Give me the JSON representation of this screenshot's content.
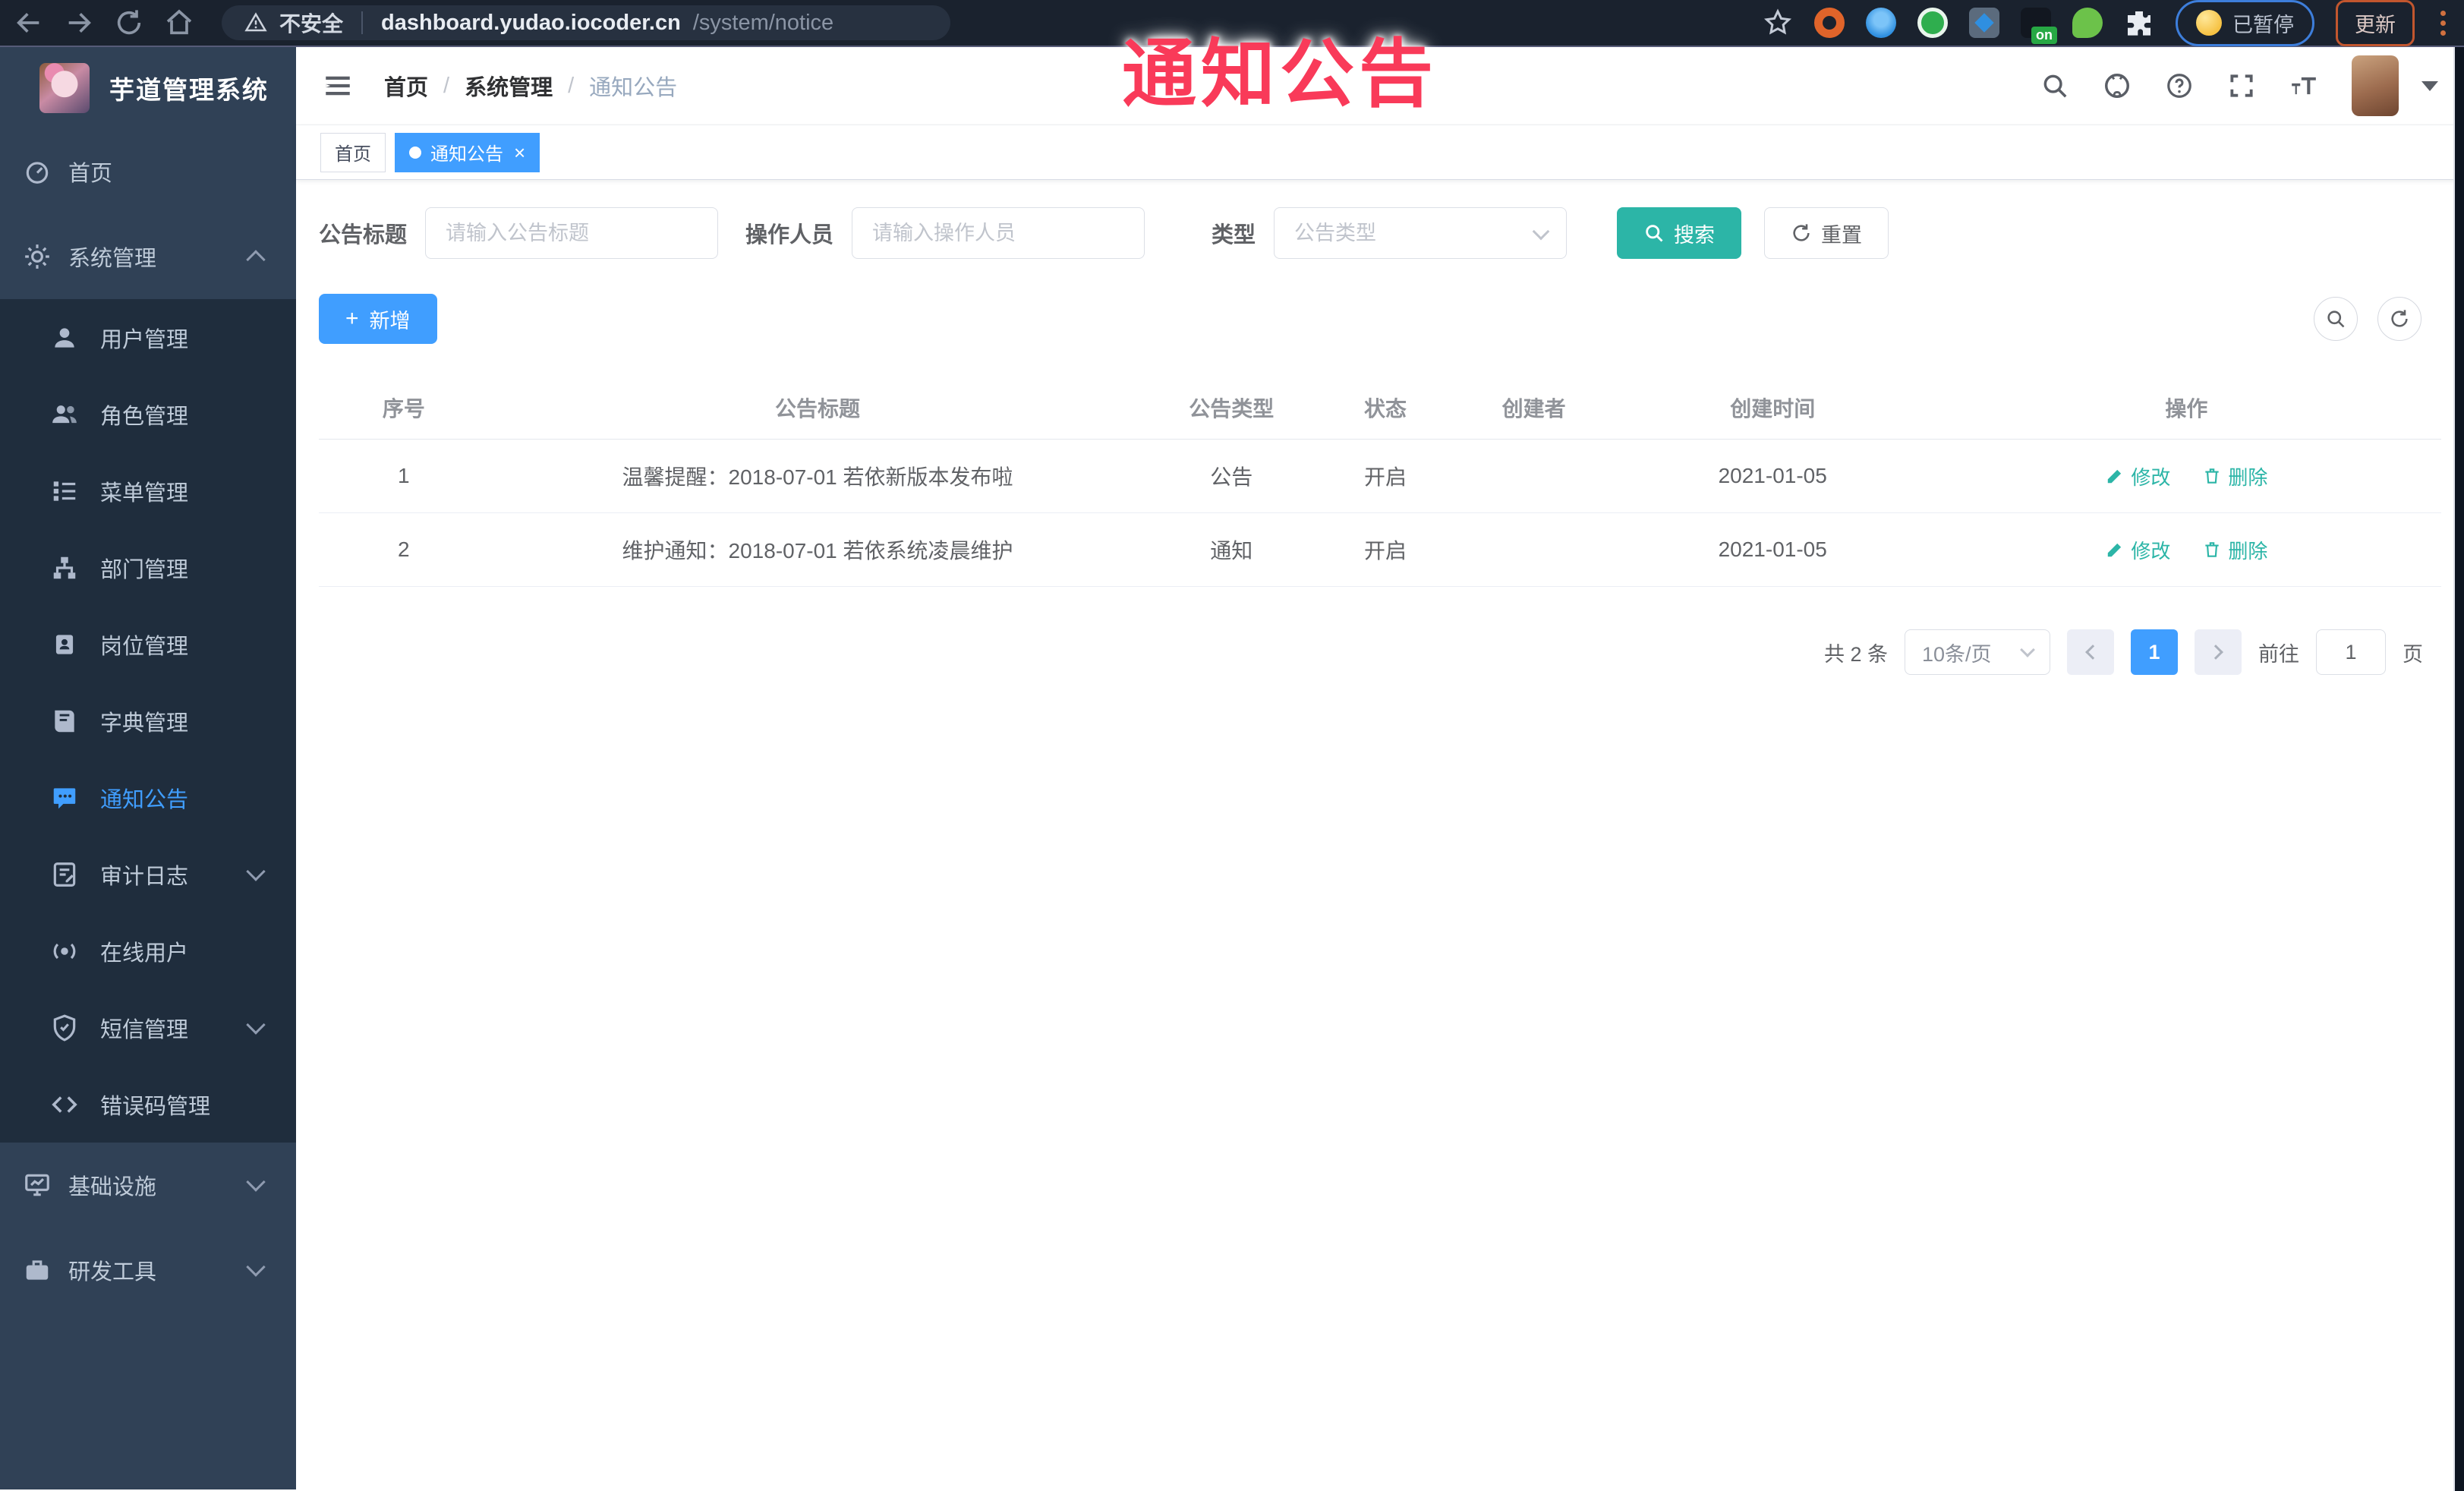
{
  "browser": {
    "security_label": "不安全",
    "url_host": "dashboard.yudao.iocoder.cn",
    "url_path": "/system/notice",
    "extension_on_badge": "on",
    "paused_label": "已暂停",
    "update_label": "更新",
    "icons": [
      "back-icon",
      "forward-icon",
      "reload-icon",
      "home-icon",
      "warning-icon",
      "star-icon",
      "extensions-puzzle-icon",
      "kebab-menu-icon"
    ]
  },
  "overlay": {
    "title": "通知公告"
  },
  "sidebar": {
    "app_title": "芋道管理系统",
    "items": [
      {
        "label": "首页",
        "icon": "dashboard-icon"
      },
      {
        "label": "系统管理",
        "icon": "gear-icon",
        "expanded": true
      },
      {
        "label": "用户管理",
        "icon": "user-icon"
      },
      {
        "label": "角色管理",
        "icon": "users-icon"
      },
      {
        "label": "菜单管理",
        "icon": "menu-list-icon"
      },
      {
        "label": "部门管理",
        "icon": "org-tree-icon"
      },
      {
        "label": "岗位管理",
        "icon": "id-card-icon"
      },
      {
        "label": "字典管理",
        "icon": "book-icon"
      },
      {
        "label": "通知公告",
        "icon": "message-icon",
        "active": true
      },
      {
        "label": "审计日志",
        "icon": "log-icon",
        "chevron": "down"
      },
      {
        "label": "在线用户",
        "icon": "online-user-icon"
      },
      {
        "label": "短信管理",
        "icon": "shield-check-icon",
        "chevron": "down"
      },
      {
        "label": "错误码管理",
        "icon": "code-icon"
      },
      {
        "label": "基础设施",
        "icon": "monitor-icon",
        "chevron": "down"
      },
      {
        "label": "研发工具",
        "icon": "briefcase-icon",
        "chevron": "down"
      }
    ]
  },
  "navbar": {
    "breadcrumb": [
      "首页",
      "系统管理",
      "通知公告"
    ],
    "icons": [
      "search-icon",
      "github-icon",
      "help-icon",
      "fullscreen-icon",
      "font-size-icon",
      "avatar",
      "caret-down-icon"
    ]
  },
  "tabs": {
    "home_label": "首页",
    "active_label": "通知公告"
  },
  "filter": {
    "title_label": "公告标题",
    "title_placeholder": "请输入公告标题",
    "operator_label": "操作人员",
    "operator_placeholder": "请输入操作人员",
    "type_label": "类型",
    "type_placeholder": "公告类型",
    "search_label": "搜索",
    "reset_label": "重置"
  },
  "toolbar": {
    "add_label": "新增"
  },
  "table": {
    "headers": [
      "序号",
      "公告标题",
      "公告类型",
      "状态",
      "创建者",
      "创建时间",
      "操作"
    ],
    "rows": [
      {
        "index": "1",
        "title": "温馨提醒：2018-07-01 若依新版本发布啦",
        "type": "公告",
        "status": "开启",
        "creator": "",
        "created": "2021-01-05"
      },
      {
        "index": "2",
        "title": "维护通知：2018-07-01 若依系统凌晨维护",
        "type": "通知",
        "status": "开启",
        "creator": "",
        "created": "2021-01-05"
      }
    ],
    "edit_label": "修改",
    "delete_label": "删除"
  },
  "pagination": {
    "total_label": "共 2 条",
    "page_size_label": "10条/页",
    "current_page": "1",
    "goto_label": "前往",
    "goto_value": "1",
    "page_unit_label": "页"
  },
  "colors": {
    "primary": "#409eff",
    "teal": "#2cb5a7",
    "sidebar_bg": "#304156",
    "submenu_bg": "#1f2d3d",
    "overlay_red": "#f93a59"
  }
}
